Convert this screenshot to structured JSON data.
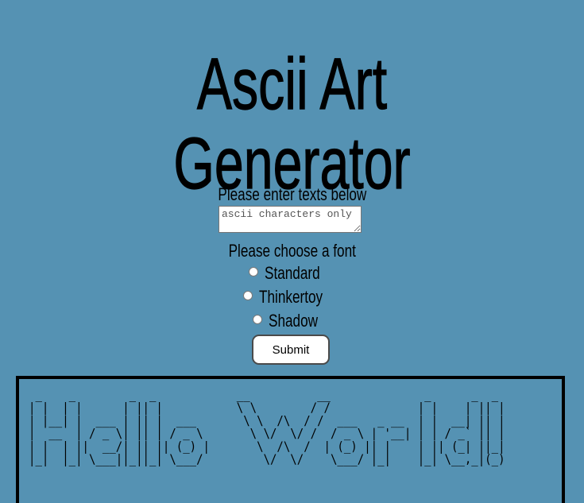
{
  "page": {
    "title": "Ascii Art Generator",
    "background_color": "#5592b3"
  },
  "form": {
    "text_label": "Please enter texts below",
    "text_placeholder": "ascii characters only",
    "font_label": "Please choose a font",
    "fonts": [
      {
        "label": "Standard",
        "selected": false
      },
      {
        "label": "Thinkertoy",
        "selected": false
      },
      {
        "label": "Shadow",
        "selected": false
      }
    ],
    "submit_label": "Submit"
  },
  "output": {
    "ascii_art": " _    _        _  _            __          __              _      _  _ \n| |  | |      | || |           \\ \\        / /             | |    | || |\n| |__| |  ___ | || |  ___       \\ \\  /\\  / /  ___   _ __  | |  __| || |\n|  __  | / _ \\| || | / _ \\       \\ \\/  \\/ /  / _ \\ | '__| | | / _` || |\n| |  | ||  __/| || || (_) |       \\  /\\  /  | (_) || |    | || (_| ||_|\n|_|  |_| \\___||_||_| \\___/         \\/  \\/    \\___/ |_|    |_| \\__,_|(_)"
  }
}
